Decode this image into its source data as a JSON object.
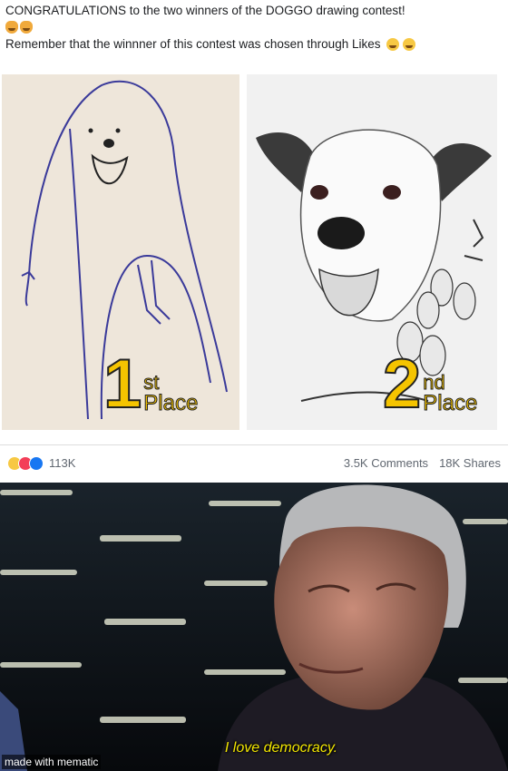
{
  "post": {
    "line1": "CONGRATULATIONS to the two winners of the DOGGO drawing contest!",
    "line2": "Remember that the winnner of this contest was chosen through Likes",
    "line1_emojis": [
      "cat-face-icon",
      "cat-face-icon"
    ],
    "line2_emojis": [
      "grimacing-face-icon",
      "grimacing-face-icon"
    ]
  },
  "panels": [
    {
      "place_number": "1",
      "place_suffix": "st",
      "place_word": "Place",
      "artwork": "crude-dog-drawing"
    },
    {
      "place_number": "2",
      "place_suffix": "nd",
      "place_word": "Place",
      "artwork": "realistic-dog-sketch"
    }
  ],
  "stats": {
    "reaction_icons": [
      "haha-reaction-icon",
      "love-reaction-icon",
      "like-reaction-icon"
    ],
    "reactions_count": "113K",
    "comments": "3.5K Comments",
    "shares": "18K Shares"
  },
  "meme": {
    "caption": "I love democracy.",
    "watermark": "made with mematic"
  },
  "colors": {
    "place_badge": "#f5c400",
    "caption": "#f2e600",
    "panel1_bg": "#eee6da",
    "panel2_bg": "#f1f1f1"
  }
}
